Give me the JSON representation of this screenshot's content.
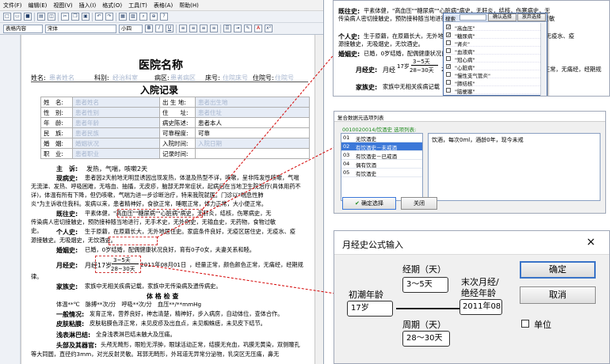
{
  "menu": [
    "文件(F)",
    "编辑(E)",
    "视图(V)",
    "插入(I)",
    "格式(O)",
    "工具(T)",
    "表格(A)",
    "帮助(H)"
  ],
  "toolbar": {
    "style_select": "表格内容",
    "font_select": "宋体",
    "size_select": "小四"
  },
  "doc": {
    "hospital_name": "医院名称",
    "header_fields": [
      {
        "label": "姓名:",
        "value": "患者姓名"
      },
      {
        "label": "科别:",
        "value": "经治科室"
      },
      {
        "label": "病区:",
        "value": "患者病区"
      },
      {
        "label": "床号:",
        "value": "住院床号"
      },
      {
        "label": "住院号:",
        "value": "住院号"
      }
    ],
    "title": "入院记录",
    "rows": [
      {
        "l1": "姓　名:",
        "v1": "患者姓名",
        "l2": "出 生 地:",
        "v2": "患者出生地"
      },
      {
        "l1": "性　别:",
        "v1": "患者性别",
        "l2": "住　　址:",
        "v2": "患者住址"
      },
      {
        "l1": "年　龄:",
        "v1": "患者年龄",
        "l2": "病史陈述:",
        "v2": "患者本人"
      },
      {
        "l1": "民　族:",
        "v1": "患者民族",
        "l2": "可靠程度:",
        "v2": "可靠"
      },
      {
        "l1": "婚　姻:",
        "v1": "婚姻状况",
        "l2": "入院时间:",
        "v2": "入院日期"
      },
      {
        "l1": "职　业:",
        "v1": "患者职业",
        "l2": "记录时间:",
        "v2": ""
      }
    ],
    "chief_label": "主　诉:",
    "chief_text": "发热，气喘，咳嗽2天",
    "present_label": "现病史:",
    "present_lines": [
      "患者因2天前地无明显诱因出现发热，体温及热型不详，咳嗽，呈非阵发性咳嗽，气喘",
      "无流涕、发热、呼吸困难，无咯血、抽搐，无皮疹，脑部无异常症状，起病后在当地卫生院治疗(具体用药不",
      "详)，体温有所有下降，但仍咳嗽，气喘为进一步诊断治疗，特来我院就医。门诊以\"喘息性肺",
      "炎\"为主诉收住我科。发病以来，患者精神好，食欲正常，睡眠正常，体力正常，大小便正常。"
    ],
    "past_label": "既往史:",
    "past_lines": [
      "平素体健，\"高血压\"\"糖尿病\"\"心脏病\"病史，无肝炎，结核，伤寒病史，无",
      "传染病人密切接触史，预防接种随当地进行，无手术史，无外伤史，无输血史，无药物，食物过敏",
      "史。"
    ],
    "personal_label": "个人史:",
    "personal_lines": [
      "生于原籍，在原籍长大，无外地居住史。家庭条件良好，无疫区居住史，无疫水、疫",
      "源接触史。无吸烟史，无饮酒史。"
    ],
    "marital_label": "婚姻史:",
    "marital_text": "已婚，0岁结婚，配偶健康状况良好，育有0子0女，夫妻关系和睦。",
    "menstrual_label": "月经史:",
    "menstrual_pre": "月经",
    "menstrual_age": "17岁",
    "menstrual_top": "3~5天",
    "menstrual_bottom": "28~30天",
    "menstrual_date": "2011年08月01日",
    "menstrual_post": "，经量正常，颜色颜色正常，无痛经，经期规",
    "menstrual_tail": "律。",
    "family_label": "家族史:",
    "family_text": "家族中无相关疾病记载，家族中无传染病及遗传病史。",
    "exam_title": "体 格 检 查",
    "vitals": "体温**℃　脉搏**次/分　呼吸**次/分　血压**/**mmHg",
    "general_label": "一般情况:",
    "general_text": "发育正常，营养良好，神志清楚，精神好，步入病房，自动体位，查体合作。",
    "skin_label": "皮肤粘膜:",
    "skin_text": "皮肤粘膜色泽正常，未见皮疹及出血点，未见蜘蛛痣，未见皮下结节。",
    "lymph_label": "浅表淋巴结:",
    "lymph_text": "全身浅表淋巴结未触大及压痛。",
    "head_label": "头部及其器官:",
    "head_text": "头颅无畸形，眼睑无浮肿，眼球活动正常，结膜无充血，巩膜无黄染，双侧瞳孔",
    "head_tail": "等大同圆，直径约3mm，对光反射灵敏。耳郭无畸形，外耳道无异常分泌物，乳突区无压痛，鼻无"
  },
  "popup1": {
    "past_label": "既往史:",
    "past_line": "平素体健，\"高血压\"\"糖尿病\"\"心脏病\"病史，无肝炎，结核，伤寒病史，无",
    "past_line2": "传染病人密切接触史，预防接种随当地进行，无手术史，无外伤史，无药物，食物过敏",
    "search_label": "搜索",
    "confirm_label": "确认选择",
    "cancel_label": "放弃选择",
    "items": [
      {
        "label": "\"高血压\"",
        "checked": true
      },
      {
        "label": "\"糖尿病\"",
        "checked": true
      },
      {
        "label": "\"肾炎\"",
        "checked": false
      },
      {
        "label": "\"血液病\"",
        "checked": false
      },
      {
        "label": "\"冠心病\"",
        "checked": false
      },
      {
        "label": "\"心脏病\"",
        "checked": true
      },
      {
        "label": "\"慢性支气管炎\"",
        "checked": false
      },
      {
        "label": "\"肺结核\"",
        "checked": false
      },
      {
        "label": "\"脑梗塞\"",
        "checked": false
      }
    ],
    "personal_label": "个人史:",
    "personal_line": "生于原籍，在原籍长大，无外地居住史。家庭条件良好，无疫区居住史，无疫水、疫",
    "personal_line2": "源接触史，无吸烟史，无饮酒史。",
    "marital_label": "婚姻史:",
    "marital_text": "已婚，0岁结婚，配偶健康状况良好，育有0子0女，夫妻关系和睦。",
    "menstrual_label": "月经史:",
    "menstrual_pre": "月经",
    "menstrual_age": "17岁",
    "menstrual_top": "3~5天",
    "menstrual_bottom": "28~30天",
    "menstrual_post": "2011年08月01日，经量正常，颜色颜色正常，无痛经，经期规",
    "family_label": "家族史:",
    "family_text": "家族中无相关疾病记载"
  },
  "popup2": {
    "title": "复合数据元选项列表",
    "subtitle": "0010020014/饮酒史 选项列表:",
    "rows": [
      {
        "num": "01",
        "label": "无饮酒史"
      },
      {
        "num": "02",
        "label": "有饮酒史－未戒酒"
      },
      {
        "num": "03",
        "label": "有饮酒史－已戒酒"
      },
      {
        "num": "04",
        "label": "偶有饮酒"
      },
      {
        "num": "05",
        "label": "有饮酒史"
      }
    ],
    "selected_index": 1,
    "detail": "饮酒，每次0ml，酒龄0年，现今未戒",
    "ok_label": "确定选择",
    "close_label": "关闭"
  },
  "popup3": {
    "title": "月经史公式输入",
    "close": "×",
    "first_age_label": "初潮年龄",
    "first_age_value": "17岁",
    "period_label": "经期（天）",
    "period_value": "3～5天",
    "cycle_label": "周期（天）",
    "cycle_value": "28～30天",
    "last_label_1": "末次月经/",
    "last_label_2": "绝经年龄",
    "last_value": "2011年08",
    "ok": "确定",
    "cancel": "取消",
    "unit": "单位"
  }
}
